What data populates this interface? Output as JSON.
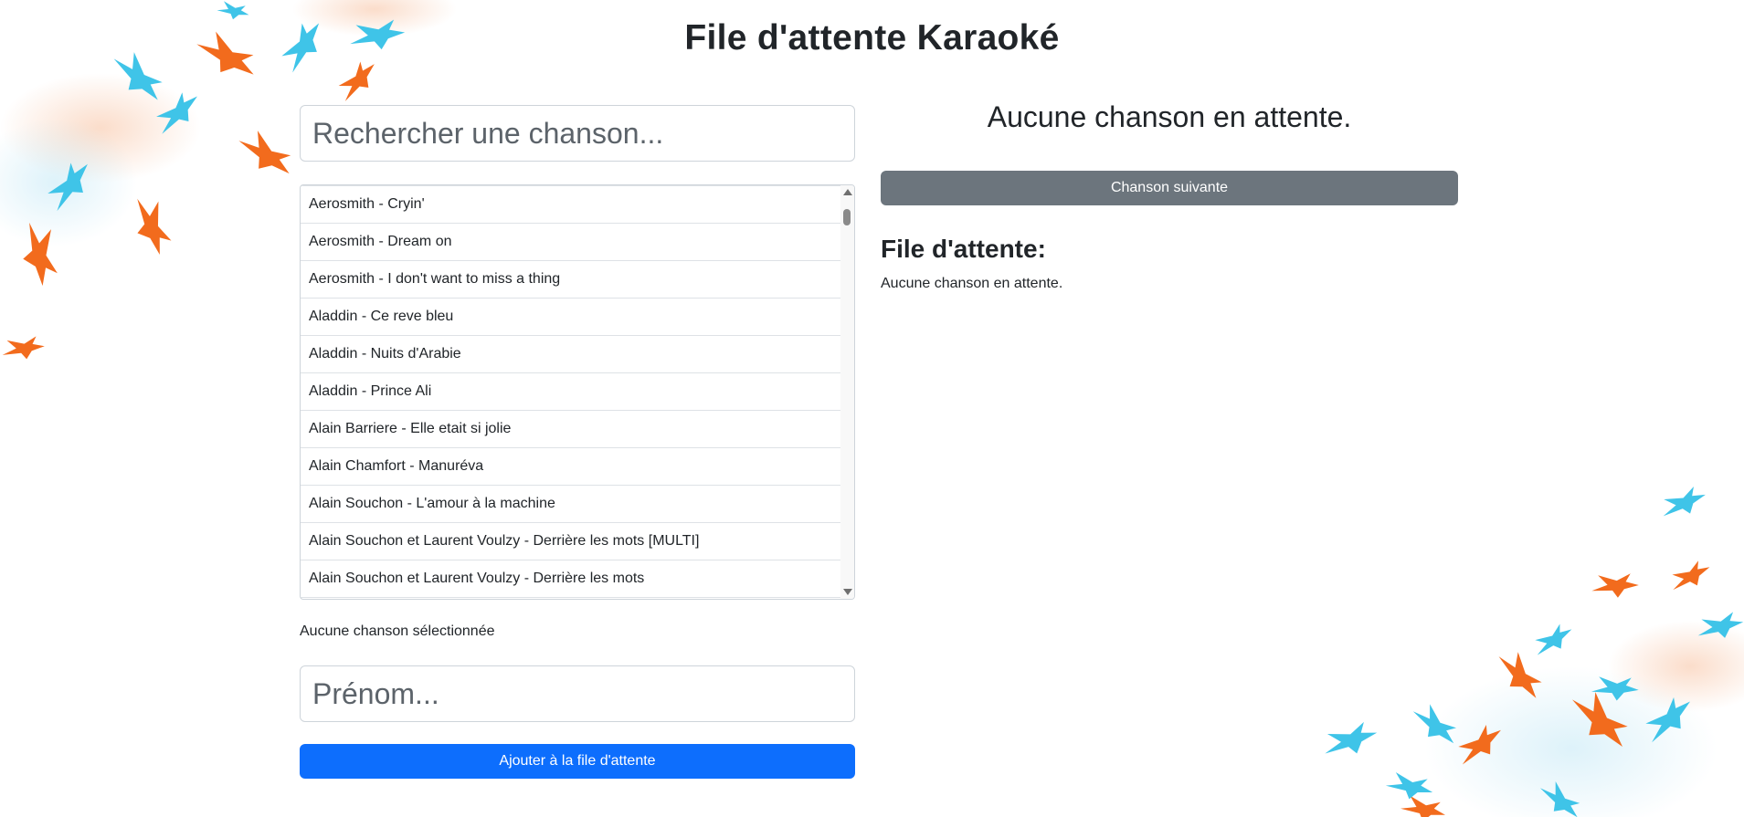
{
  "header": {
    "title": "File d'attente Karaoké"
  },
  "search": {
    "placeholder": "Rechercher une chanson..."
  },
  "song_list": {
    "items": [
      "Aerosmith - Cryin'",
      "Aerosmith - Dream on",
      "Aerosmith - I don't want to miss a thing",
      "Aladdin - Ce reve bleu",
      "Aladdin - Nuits d'Arabie",
      "Aladdin - Prince Ali",
      "Alain Barriere - Elle etait si jolie",
      "Alain Chamfort - Manuréva",
      "Alain Souchon - L'amour à la machine",
      "Alain Souchon et Laurent Voulzy - Derrière les mots [MULTI]",
      "Alain Souchon et Laurent Voulzy - Derrière les mots"
    ]
  },
  "selection": {
    "status": "Aucune chanson sélectionnée"
  },
  "name_field": {
    "placeholder": "Prénom..."
  },
  "buttons": {
    "add_to_queue": "Ajouter à la file d'attente",
    "next_song": "Chanson suivante"
  },
  "now_playing": {
    "text": "Aucune chanson en attente."
  },
  "queue": {
    "heading": "File d'attente:",
    "empty_text": "Aucune chanson en attente."
  },
  "colors": {
    "primary": "#0d6efd",
    "secondary": "#6c757d",
    "bird_orange": "#f26b1d",
    "bird_blue": "#3fc4e8"
  }
}
